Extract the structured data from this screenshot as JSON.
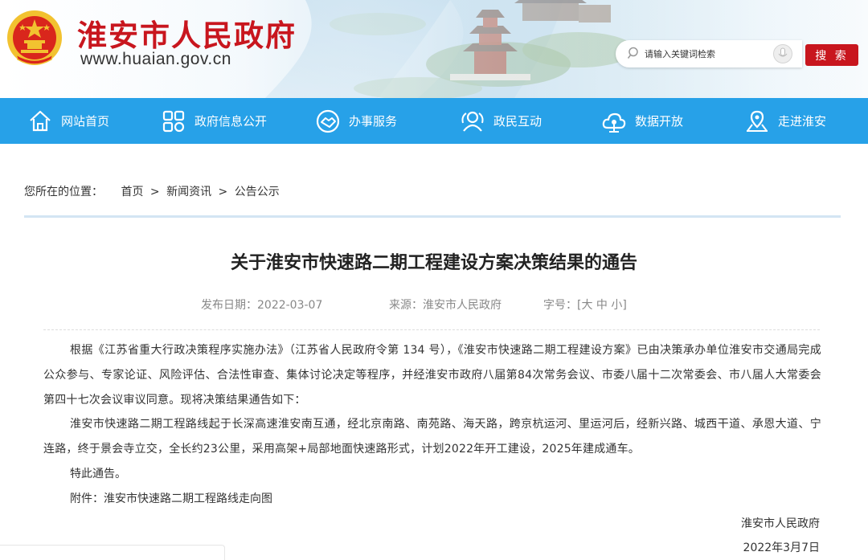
{
  "header": {
    "site_name": "淮安市人民政府",
    "site_url": "www.huaian.gov.cn",
    "search_placeholder": "请输入关键词检索",
    "search_button": "搜 索"
  },
  "nav": {
    "items": [
      {
        "label": "网站首页",
        "icon": "home-icon"
      },
      {
        "label": "政府信息公开",
        "icon": "grid-icon"
      },
      {
        "label": "办事服务",
        "icon": "handshake-icon"
      },
      {
        "label": "政民互动",
        "icon": "people-icon"
      },
      {
        "label": "数据开放",
        "icon": "cloud-data-icon"
      },
      {
        "label": "走进淮安",
        "icon": "map-pin-icon"
      }
    ]
  },
  "breadcrumb": {
    "prefix": "您所在的位置：",
    "items": [
      "首页",
      "新闻资讯",
      "公告公示"
    ],
    "separator": ">"
  },
  "article": {
    "title": "关于淮安市快速路二期工程建设方案决策结果的通告",
    "publish_date": "发布日期：2022-03-07",
    "source": "来源：淮安市人民政府",
    "font_size_label": "字号：[大 中 小]",
    "paragraphs": [
      "根据《江苏省重大行政决策程序实施办法》（江苏省人民政府令第 134 号），《淮安市快速路二期工程建设方案》已由决策承办单位淮安市交通局完成公众参与、专家论证、风险评估、合法性审查、集体讨论决定等程序，并经淮安市政府八届第84次常务会议、市委八届十二次常委会、市八届人大常委会第四十七次会议审议同意。现将决策结果通告如下：",
      "淮安市快速路二期工程路线起于长深高速淮安南互通，经北京南路、南苑路、海天路，跨京杭运河、里运河后，经新兴路、城西干道、承恩大道、宁连路，终于景会寺立交，全长约23公里，采用高架+局部地面快速路形式，计划2022年开工建设，2025年建成通车。",
      "特此通告。",
      "附件：淮安市快速路二期工程路线走向图"
    ],
    "signature_org": "淮安市人民政府",
    "signature_date": "2022年3月7日"
  },
  "colors": {
    "brand_red": "#c8161e",
    "nav_blue": "#27a1e8"
  }
}
